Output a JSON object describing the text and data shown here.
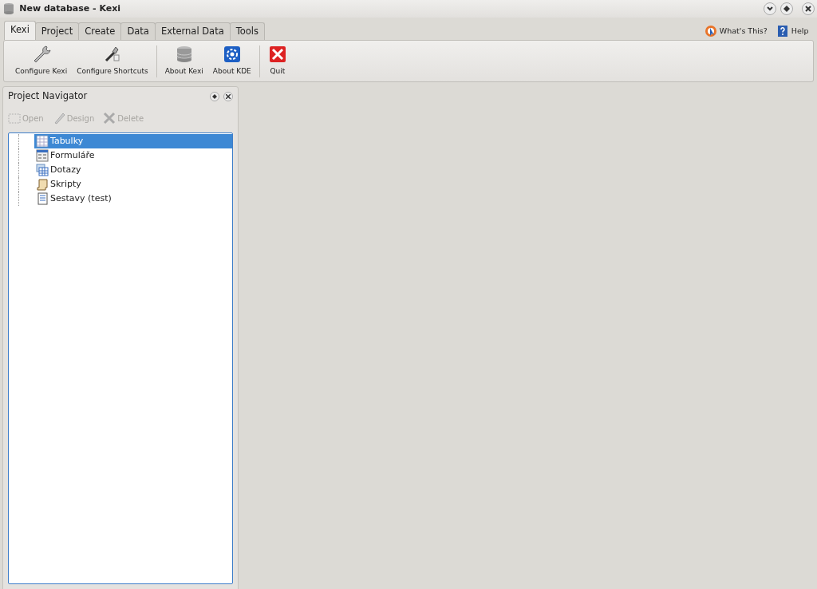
{
  "window": {
    "title": "New database - Kexi"
  },
  "tabs": [
    {
      "label": "Kexi",
      "selected": true
    },
    {
      "label": "Project",
      "selected": false
    },
    {
      "label": "Create",
      "selected": false
    },
    {
      "label": "Data",
      "selected": false
    },
    {
      "label": "External Data",
      "selected": false
    },
    {
      "label": "Tools",
      "selected": false
    }
  ],
  "help_links": [
    {
      "label": "What's This?",
      "kind": "whatsthis"
    },
    {
      "label": "Help",
      "kind": "help"
    }
  ],
  "ribbon": [
    {
      "label": "Configure Kexi",
      "kind": "wrench"
    },
    {
      "label": "Configure Shortcuts",
      "kind": "shortcuts"
    },
    {
      "kind": "separator"
    },
    {
      "label": "About Kexi",
      "kind": "db"
    },
    {
      "label": "About KDE",
      "kind": "kde"
    },
    {
      "kind": "separator"
    },
    {
      "label": "Quit",
      "kind": "quit"
    }
  ],
  "navigator": {
    "title": "Project Navigator",
    "actions": [
      {
        "label": "Open",
        "disabled": true,
        "kind": "open"
      },
      {
        "label": "Design",
        "disabled": true,
        "kind": "design"
      },
      {
        "label": "Delete",
        "disabled": true,
        "kind": "delete"
      }
    ],
    "items": [
      {
        "label": "Tabulky",
        "selected": true,
        "kind": "table"
      },
      {
        "label": "Formuláře",
        "selected": false,
        "kind": "form"
      },
      {
        "label": "Dotazy",
        "selected": false,
        "kind": "query"
      },
      {
        "label": "Skripty",
        "selected": false,
        "kind": "script"
      },
      {
        "label": "Sestavy (test)",
        "selected": false,
        "kind": "report"
      }
    ]
  }
}
